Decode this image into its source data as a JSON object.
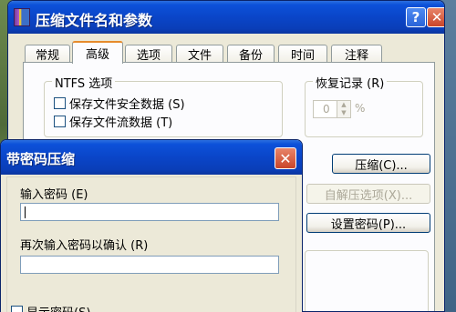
{
  "main_window": {
    "title": "压缩文件名和参数",
    "help_glyph": "?",
    "close_glyph": "✕"
  },
  "tabs": [
    "常规",
    "高级",
    "选项",
    "文件",
    "备份",
    "时间",
    "注释"
  ],
  "active_tab": "高级",
  "ntfs": {
    "group_label": "NTFS 选项",
    "save_security": "保存文件安全数据 (S)",
    "save_streams": "保存文件流数据 (T)"
  },
  "recovery": {
    "group_label": "恢复记录 (R)",
    "value": "0",
    "unit": "%"
  },
  "buttons": {
    "compress": "压缩(C)...",
    "sfx_options": "自解压选项(X)...",
    "set_password": "设置密码(P)..."
  },
  "password_dialog": {
    "title": "带密码压缩",
    "close_glyph": "✕",
    "enter_password_label": "输入密码 (E)",
    "enter_password_value": "",
    "confirm_password_label": "再次输入密码以确认 (R)",
    "confirm_password_value": "",
    "show_password_label": "显示密码(S)"
  },
  "colors": {
    "titlebar": "#0a45c8",
    "active_tab_accent": "#e68b2c",
    "window_bg": "#ece9d8"
  }
}
